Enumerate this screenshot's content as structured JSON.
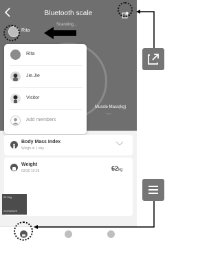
{
  "header": {
    "title": "Bluetooth scale",
    "back_icon": "chevron-left-icon",
    "share_icon": "share-icon",
    "status": "Scanning..."
  },
  "current_user": {
    "name": "Rita"
  },
  "dropdown": {
    "items": [
      {
        "label": "Rita",
        "icon": "user-avatar"
      },
      {
        "label": "Jie.Jie",
        "icon": "user-avatar"
      },
      {
        "label": "Visitor",
        "icon": "user-avatar"
      },
      {
        "label": "Add members",
        "icon": "add-member-icon"
      }
    ]
  },
  "metrics": {
    "muscle_mass_label": "Muscle Mass(kg)",
    "muscle_mass_value": "--.--"
  },
  "bmi_card": {
    "title": "Body Mass Index",
    "subtitle": "Weigh in 1 day"
  },
  "weight_card": {
    "title": "Weight",
    "date": "03/30 10:25",
    "value": "62",
    "unit": "kg",
    "bar_label": "62.0kg",
    "bar_date": "2024/03/29"
  },
  "nav": {
    "items": [
      "list-icon",
      "clock-icon",
      "profile-icon"
    ]
  },
  "colors": {
    "header_bg": "#6f6f6f",
    "accent_dark": "#4c4c4c",
    "side_button": "#757575"
  }
}
